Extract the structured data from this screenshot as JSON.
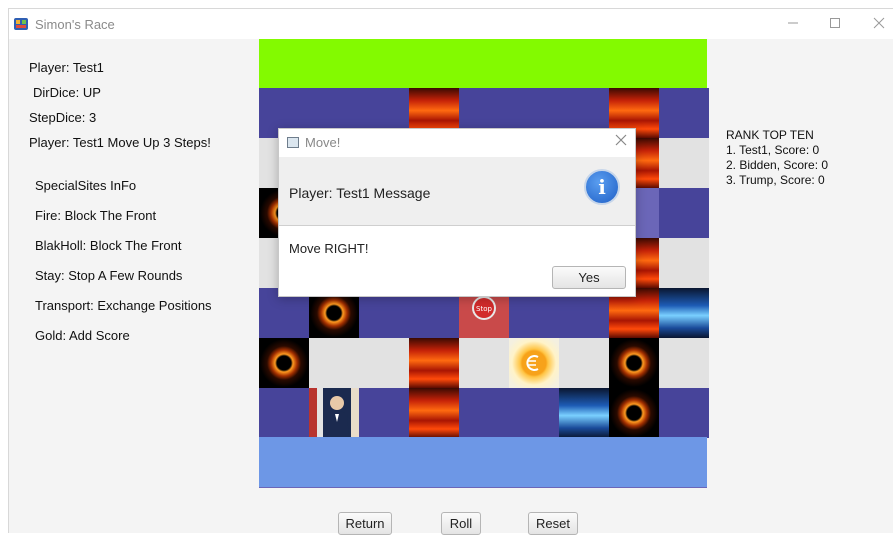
{
  "window": {
    "title": "Simon's Race"
  },
  "left_panel": {
    "player": "Player: Test1",
    "dir_dice": "DirDice: UP",
    "step_dice": "StepDice: 3",
    "move_info": "Player: Test1 Move Up 3 Steps!",
    "special_title": "SpecialSites InFo",
    "special_items": [
      "Fire: Block The Front",
      "BlakHoll: Block The Front",
      "Stay: Stop A Few Rounds",
      "Transport: Exchange Positions",
      "Gold: Add Score"
    ]
  },
  "ranking": {
    "title": "RANK TOP TEN",
    "entries": [
      "1. Test1, Score: 0",
      "2. Bidden, Score: 0",
      "3. Trump, Score: 0"
    ]
  },
  "stop_sign_text": "Stop",
  "dialog": {
    "title": "Move!",
    "header": "Player: Test1 Message",
    "message": "Move RIGHT!",
    "yes_label": "Yes"
  },
  "buttons": {
    "return_label": "Return",
    "roll_label": "Roll",
    "reset_label": "Reset"
  }
}
